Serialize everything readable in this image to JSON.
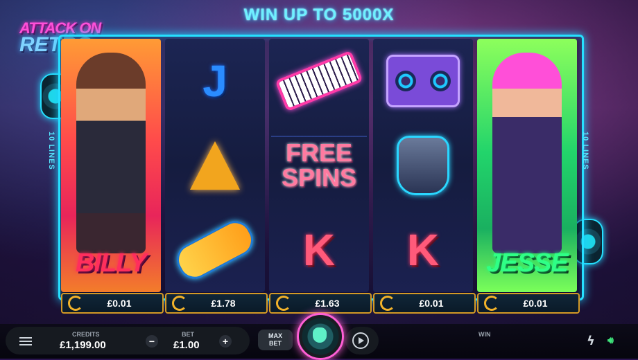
{
  "game": {
    "logo_line1": "ATTACK ON",
    "logo_line2": "RETRO",
    "headline": "WIN UP TO 5000X",
    "lines_label": "10 LINES"
  },
  "reels": [
    {
      "type": "character",
      "name": "BILLY",
      "win": "£0.01"
    },
    {
      "symbols": [
        "J",
        "A",
        "hoverboard"
      ],
      "win": "£1.78"
    },
    {
      "symbols": [
        "keytar",
        "FREE SPINS",
        "K"
      ],
      "win": "£1.63"
    },
    {
      "symbols": [
        "boombox",
        "robot-glove",
        "K"
      ],
      "win": "£0.01"
    },
    {
      "type": "character",
      "name": "JESSE",
      "win": "£0.01"
    }
  ],
  "free_spins": {
    "line1": "FREE",
    "line2": "SPINS"
  },
  "controls": {
    "credits_label": "CREDITS",
    "credits_value": "£1,199.00",
    "bet_label": "BET",
    "bet_value": "£1.00",
    "minus": "−",
    "plus": "+",
    "maxbet_line1": "MAX",
    "maxbet_line2": "BET",
    "win_label": "WIN",
    "win_value": ""
  },
  "colors": {
    "accent_cyan": "#26e0ff",
    "accent_pink": "#ff5fd6",
    "win_border": "#d49a25",
    "sound_on": "#3ee27a"
  },
  "icons": [
    "menu-icon",
    "spin-icon",
    "autoplay-icon",
    "turbo-icon",
    "sound-icon",
    "respin-icon"
  ]
}
